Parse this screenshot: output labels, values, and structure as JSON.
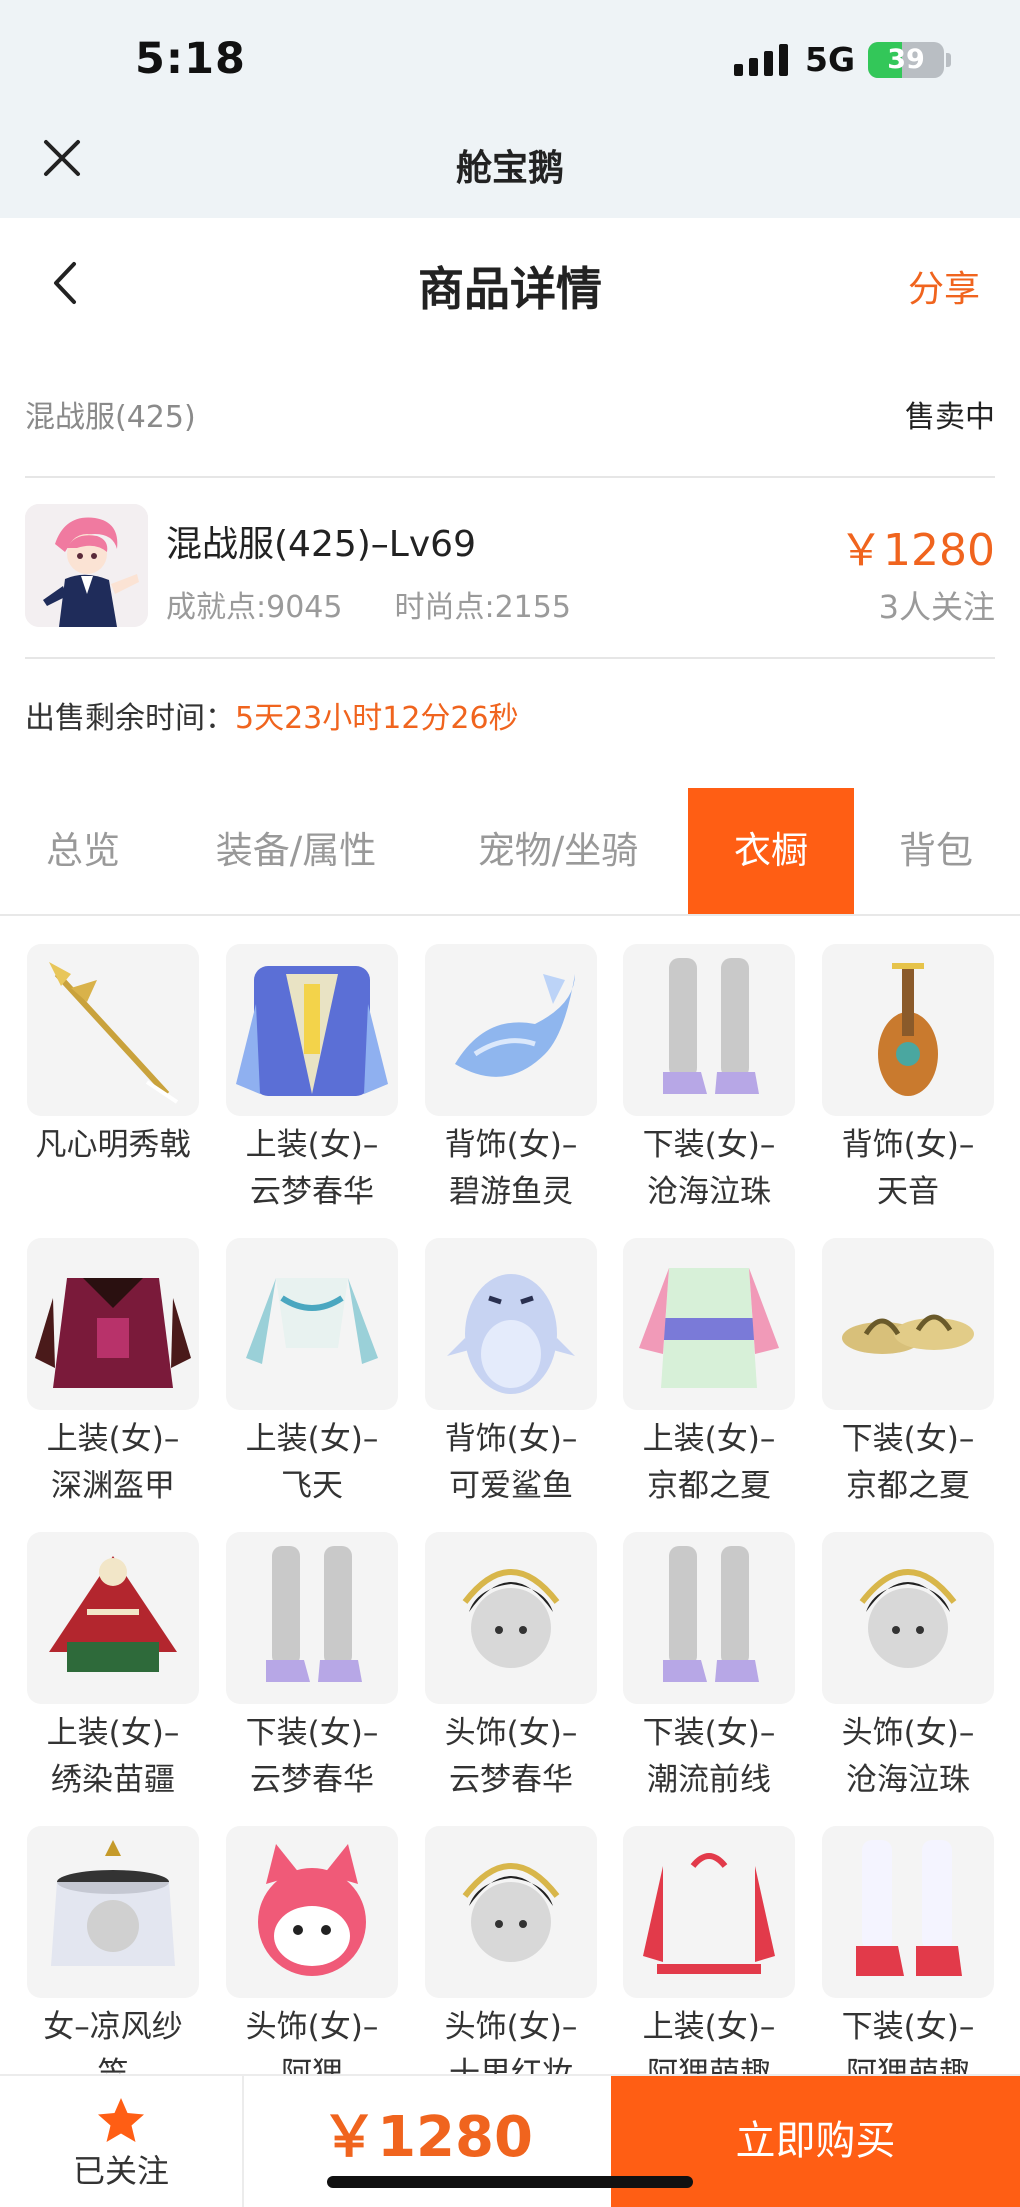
{
  "status_bar": {
    "time": "5:18",
    "network": "5G",
    "battery": "39"
  },
  "app_bar": {
    "title": "舱宝鹅"
  },
  "nav": {
    "title": "商品详情",
    "share": "分享"
  },
  "server": {
    "name": "混战服(425)",
    "status": "售卖中"
  },
  "character": {
    "name": "混战服(425)–Lv69",
    "achievement": "成就点:9045",
    "fashion": "时尚点:2155",
    "price": "￥1280",
    "followers": "3人关注"
  },
  "remaining": {
    "label": "出售剩余时间：",
    "value": "5天23小时12分26秒"
  },
  "tabs": [
    "总览",
    "装备/属性",
    "宠物/坐骑",
    "衣橱",
    "背包"
  ],
  "active_tab": "衣橱",
  "wardrobe": [
    {
      "line1": "凡心明秀戟",
      "line2": "",
      "icon": "spear-icon"
    },
    {
      "line1": "上装(女)–",
      "line2": "云梦春华",
      "icon": "robe-icon"
    },
    {
      "line1": "背饰(女)–",
      "line2": "碧游鱼灵",
      "icon": "fish-spirit-icon"
    },
    {
      "line1": "下装(女)–",
      "line2": "沧海泣珠",
      "icon": "legs-icon"
    },
    {
      "line1": "背饰(女)–",
      "line2": "天音",
      "icon": "lute-icon"
    },
    {
      "line1": "上装(女)–",
      "line2": "深渊盔甲",
      "icon": "armor-icon"
    },
    {
      "line1": "上装(女)–",
      "line2": "飞天",
      "icon": "top-icon"
    },
    {
      "line1": "背饰(女)–",
      "line2": "可爱鲨鱼",
      "icon": "shark-icon"
    },
    {
      "line1": "上装(女)–",
      "line2": "京都之夏",
      "icon": "kimono-icon"
    },
    {
      "line1": "下装(女)–",
      "line2": "京都之夏",
      "icon": "sandals-icon"
    },
    {
      "line1": "上装(女)–",
      "line2": "绣染苗疆",
      "icon": "poncho-icon"
    },
    {
      "line1": "下装(女)–",
      "line2": "云梦春华",
      "icon": "legs-icon"
    },
    {
      "line1": "头饰(女)–",
      "line2": "云梦春华",
      "icon": "headpiece-icon"
    },
    {
      "line1": "下装(女)–",
      "line2": "潮流前线",
      "icon": "legs-icon"
    },
    {
      "line1": "头饰(女)–",
      "line2": "沧海泣珠",
      "icon": "headpiece-icon"
    },
    {
      "line1": "女–凉风纱",
      "line2": "笠",
      "icon": "veil-hat-icon"
    },
    {
      "line1": "头饰(女)–",
      "line2": "阿狸",
      "icon": "ahri-fox-icon"
    },
    {
      "line1": "头饰(女)–",
      "line2": "十里红妆",
      "icon": "headpiece-icon"
    },
    {
      "line1": "上装(女)–",
      "line2": "阿狸萌趣",
      "icon": "hoodie-icon"
    },
    {
      "line1": "下装(女)–",
      "line2": "阿狸萌趣",
      "icon": "boots-icon"
    }
  ],
  "bottom_bar": {
    "follow_label": "已关注",
    "price": "￥1280",
    "buy": "立即购买"
  },
  "colors": {
    "accent": "#ff5e14",
    "price": "#f0641e"
  }
}
